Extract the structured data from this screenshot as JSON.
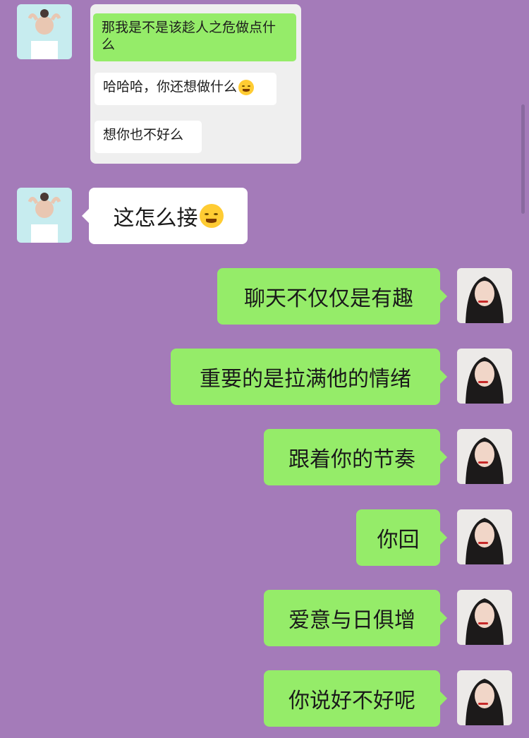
{
  "card": {
    "messages": [
      {
        "text": "那我是不是该趁人之危做点什么",
        "style": "green"
      },
      {
        "text": "哈哈哈，你还想做什么",
        "style": "white",
        "emoji": "tears-of-joy-emoji"
      },
      {
        "text": "想你也不好么",
        "style": "white"
      }
    ]
  },
  "incoming": {
    "text": "这怎么接",
    "emoji": "crying-laugh-emoji"
  },
  "outgoing": [
    {
      "text": "聊天不仅仅是有趣"
    },
    {
      "text": "重要的是拉满他的情绪"
    },
    {
      "text": "跟着你的节奏"
    },
    {
      "text": "你回"
    },
    {
      "text": "爱意与日俱增"
    },
    {
      "text": "你说好不好呢"
    }
  ],
  "colors": {
    "background": "#a47bb9",
    "green_bubble": "#95ec69",
    "white_bubble": "#ffffff"
  },
  "icons": {
    "avatar_left": "avatar-woman-hair-bun",
    "avatar_right": "avatar-woman-dark-hair"
  }
}
